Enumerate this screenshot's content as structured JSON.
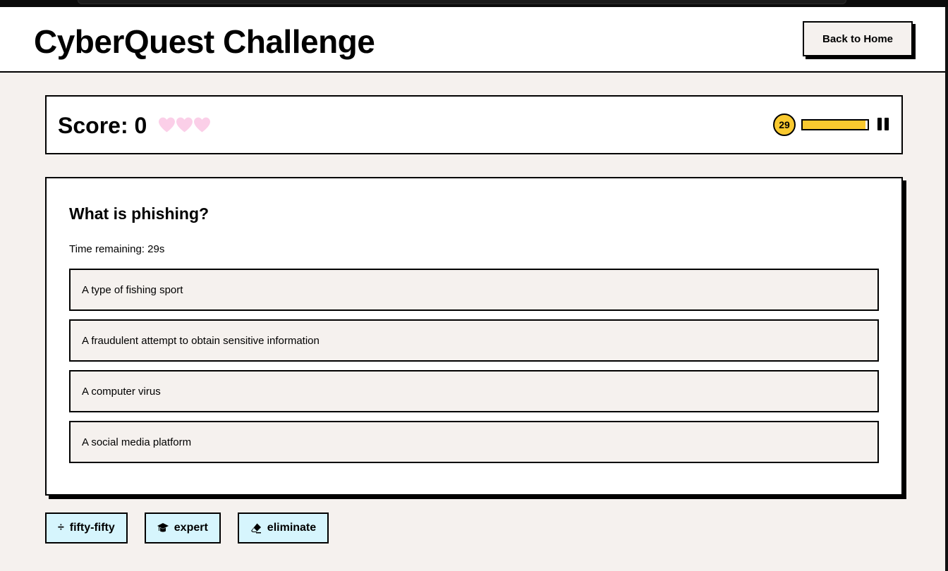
{
  "header": {
    "title": "CyberQuest Challenge",
    "home_button": "Back to Home"
  },
  "status": {
    "score_label": "Score: 0",
    "lives": 3,
    "timer_value": "29",
    "timer_fraction": 0.97
  },
  "question": {
    "text": "What is phishing?",
    "time_remaining": "Time remaining: 29s",
    "options": [
      "A type of fishing sport",
      "A fraudulent attempt to obtain sensitive information",
      "A computer virus",
      "A social media platform"
    ]
  },
  "lifelines": [
    {
      "label": "fifty-fifty",
      "icon": "divide-icon"
    },
    {
      "label": "expert",
      "icon": "graduation-cap-icon"
    },
    {
      "label": "eliminate",
      "icon": "eraser-icon"
    }
  ],
  "colors": {
    "accent_yellow": "#f9c92f",
    "heart_pink": "#fbcfe8",
    "lifeline_bg": "#d6f5fd",
    "page_bg": "#f5f1ee"
  }
}
